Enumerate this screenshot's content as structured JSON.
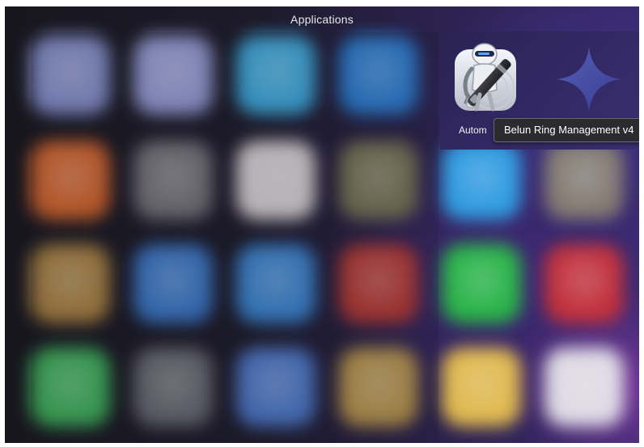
{
  "header": {
    "title": "Applications"
  },
  "sharp_apps": [
    {
      "label": "Autom",
      "icon": "automator-icon"
    },
    {
      "label": "",
      "icon": "diamond-app-icon"
    }
  ],
  "tooltip": {
    "text": "Belun Ring Management v4"
  },
  "blurred_grid": {
    "colors": [
      [
        "#8f9bdc",
        "#a1a8e6",
        "#3fb7ee",
        "#2a86e0",
        "",
        ""
      ],
      [
        "#e56a2b",
        "#7c7a80",
        "#e9e4e4",
        "#7d7a55",
        "#2fa6ec",
        "#8a8273"
      ],
      [
        "#b68a43",
        "#3b7fd6",
        "#3b8ee0",
        "#c33a30",
        "#27c045",
        "#cd3036"
      ],
      [
        "#3fbe5e",
        "#6d6f76",
        "#4f80d8",
        "#c7a04d",
        "#f0c64d",
        "#eaeaee"
      ]
    ]
  }
}
